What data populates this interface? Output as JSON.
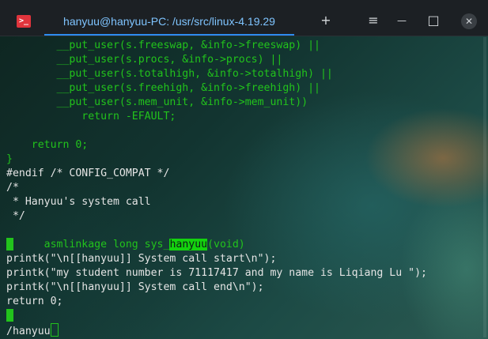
{
  "titlebar": {
    "tab_title": "hanyuu@hanyuu-PC: /usr/src/linux-4.19.29",
    "app_icon_glyph": ">_",
    "new_tab_glyph": "+",
    "menu_glyph": "≡",
    "minimize_glyph": "—",
    "maximize_glyph": "□",
    "close_glyph": "✕"
  },
  "terminal": {
    "lines": [
      "        __put_user(s.freeswap, &info->freeswap) ||",
      "        __put_user(s.procs, &info->procs) ||",
      "        __put_user(s.totalhigh, &info->totalhigh) ||",
      "        __put_user(s.freehigh, &info->freehigh) ||",
      "        __put_user(s.mem_unit, &info->mem_unit))",
      "            return -EFAULT;",
      "",
      "    return 0;",
      "}",
      "#endif /* CONFIG_COMPAT */",
      "/*",
      " * Hanyuu's system call",
      " */",
      "asmlinkage long sys_",
      "hanyuu",
      "(void)",
      "",
      "printk(\"\\n[[hanyuu]] System call start\\n\");",
      "printk(\"my student number is 71117417 and my name is Liqiang Lu \");",
      "printk(\"\\n[[hanyuu]] System call end\\n\");",
      "return 0;",
      "",
      "/hanyuu"
    ]
  },
  "colors": {
    "titlebar_bg": "#1c2024",
    "tab_text": "#7fc4ff",
    "tab_underline": "#2d8cf0",
    "app_icon": "#e0343c",
    "code_green": "#22c31c",
    "code_white": "#e5e5e5",
    "search_highlight": "#14d20e"
  }
}
